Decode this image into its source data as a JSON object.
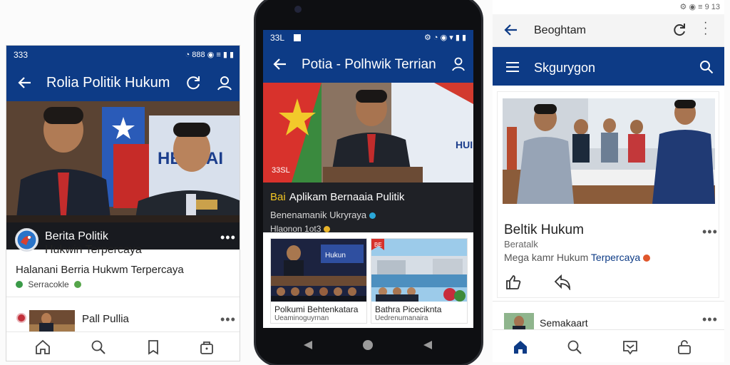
{
  "left": {
    "status_time": "333",
    "status_right": "◔ 888 ◉ ≡ ▮ ▮",
    "app_title": "Rolia Politik Hukum",
    "post_title_line1": "Berita Politik",
    "post_title_line2": "Hukwin Terpercaya",
    "post_subtitle": "Halanani Berria Hukwm Terpercaya",
    "post_meta": "Serracokle",
    "item2_title": "Pall Pullia",
    "nav": [
      "home",
      "search",
      "bookmark",
      "bag"
    ]
  },
  "center": {
    "status_time": "33L",
    "app_title": "Potia - Polhwik Terrian",
    "hero_caption": "33SL",
    "banner_title_prefix": "Bai",
    "banner_title": "Aplikam Bernaaia Pulitik",
    "banner_meta1": "Benenamanik Ukryraya",
    "banner_meta2": "Hlaonon 1ot3",
    "card1_title": "Polkumi Behtenkatara",
    "card1_meta": "Ueaminoguyrnan",
    "card2_title": "Bathra Piceciknta",
    "card2_meta": "Uedrenumanaira",
    "hero_sign": "HUI",
    "card1_sign": "Hukun",
    "card2_sign": "BE"
  },
  "right": {
    "status_text": "⚙ ◉ ≡ 9 13",
    "browser_title": "Beoghtam",
    "app_title": "Skgurygon",
    "headline": "Beltik Hukum",
    "subline": "Beratalk",
    "subline2_prefix": "Mega kamr Hukum",
    "subline2_highlight": "Terpercaya",
    "row2_title": "Semakaart"
  }
}
